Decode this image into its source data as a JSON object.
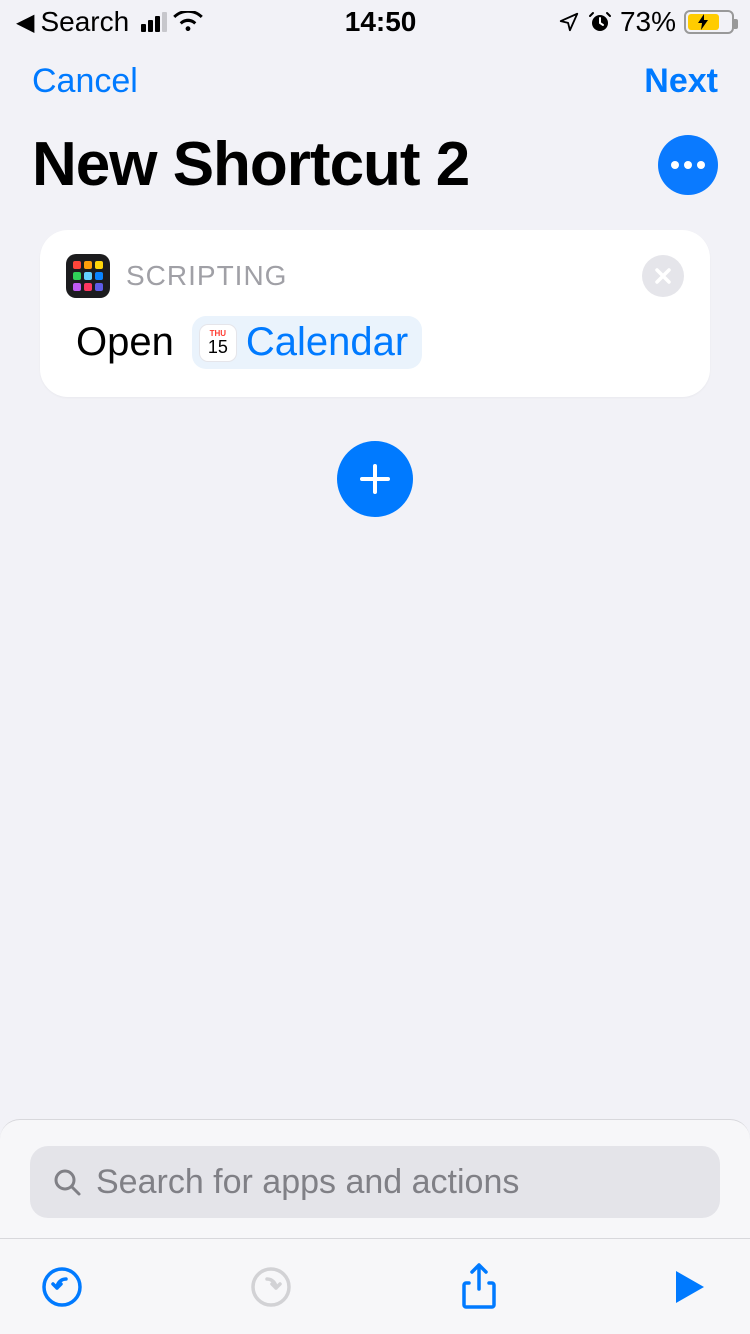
{
  "status": {
    "back_app": "Search",
    "time": "14:50",
    "battery_pct": "73%",
    "battery_level": 73
  },
  "nav": {
    "cancel": "Cancel",
    "next": "Next"
  },
  "title": "New Shortcut 2",
  "action": {
    "category": "SCRIPTING",
    "verb": "Open",
    "app_name": "Calendar",
    "cal_dow": "THU",
    "cal_day": "15"
  },
  "search": {
    "placeholder": "Search for apps and actions"
  },
  "scripting_colors": [
    "#ff453a",
    "#ff9f0a",
    "#ffd60a",
    "#30d158",
    "#64d2ff",
    "#0a84ff",
    "#bf5af2",
    "#ff375f",
    "#5e5ce6"
  ],
  "accent": "#007aff"
}
